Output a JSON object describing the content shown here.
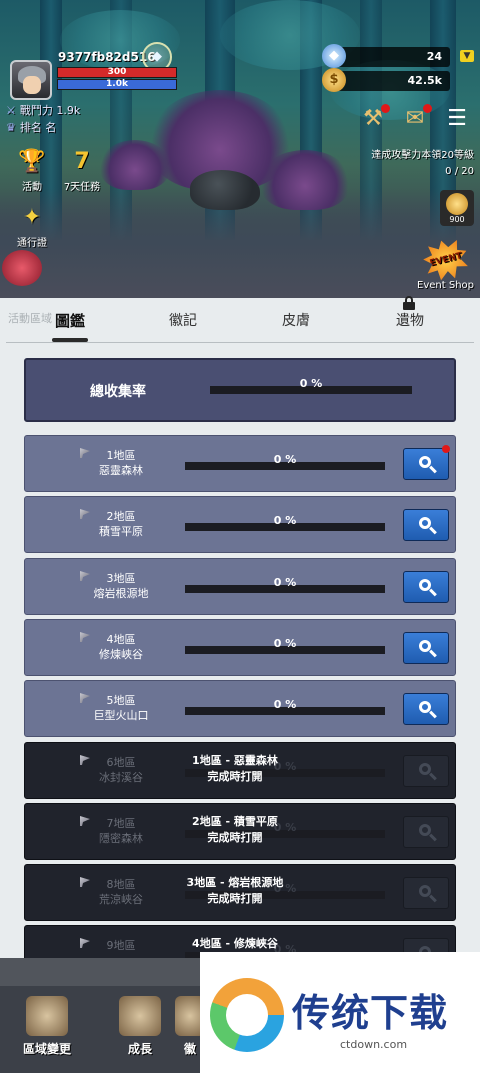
{
  "player": {
    "name": "9377fb82d516",
    "hp": "300",
    "mp": "1.0k",
    "power_label": "戰鬥力 1.9k",
    "rank_label": "排名 名"
  },
  "resources": {
    "gems": "24",
    "gold": "42.5k"
  },
  "side_buttons": [
    {
      "label": "活動",
      "icon": "trophy-icon"
    },
    {
      "label": "7天任務",
      "icon": "lightning-seven-icon"
    },
    {
      "label": "通行證",
      "icon": "pass-icon"
    }
  ],
  "quest": {
    "text": "達成攻擊力本領20等級",
    "progress": "0 / 20",
    "chest_count": "900"
  },
  "event_shop": {
    "badge": "EVENT",
    "label": "Event Shop"
  },
  "panel": {
    "bg_text": "活動區域",
    "tabs": [
      "圖鑑",
      "徽記",
      "皮膚",
      "遺物"
    ],
    "total_label": "總收集率",
    "total_percent": "0 %"
  },
  "regions": [
    {
      "zone": "1地區",
      "name": "惡靈森林",
      "percent": "0 %",
      "progress": 0,
      "locked": false,
      "notify": true
    },
    {
      "zone": "2地區",
      "name": "積雪平原",
      "percent": "0 %",
      "progress": 0,
      "locked": false,
      "notify": false
    },
    {
      "zone": "3地區",
      "name": "熔岩根源地",
      "percent": "0 %",
      "progress": 0,
      "locked": false,
      "notify": false
    },
    {
      "zone": "4地區",
      "name": "修煉峽谷",
      "percent": "0 %",
      "progress": 0,
      "locked": false,
      "notify": false
    },
    {
      "zone": "5地區",
      "name": "巨型火山口",
      "percent": "0 %",
      "progress": 0,
      "locked": false,
      "notify": false
    },
    {
      "zone": "6地區",
      "name": "冰封溪谷",
      "percent": "0 %",
      "progress": 0,
      "locked": true,
      "unlock_title": "1地區 - 惡靈森林",
      "unlock_desc": "完成時打開"
    },
    {
      "zone": "7地區",
      "name": "隱密森林",
      "percent": "0 %",
      "progress": 0,
      "locked": true,
      "unlock_title": "2地區 - 積雪平原",
      "unlock_desc": "完成時打開"
    },
    {
      "zone": "8地區",
      "name": "荒涼峽谷",
      "percent": "0 %",
      "progress": 0,
      "locked": true,
      "unlock_title": "3地區 - 熔岩根源地",
      "unlock_desc": "完成時打開"
    },
    {
      "zone": "9地區",
      "name": "",
      "percent": "0 %",
      "progress": 0,
      "locked": true,
      "unlock_title": "4地區 - 修煉峽谷",
      "unlock_desc": ""
    }
  ],
  "bottom_nav": [
    {
      "label": "區域變更"
    },
    {
      "label": "成長"
    },
    {
      "label": "徽"
    }
  ],
  "watermark": {
    "title": "传统下载",
    "url": "ctdown.com"
  }
}
